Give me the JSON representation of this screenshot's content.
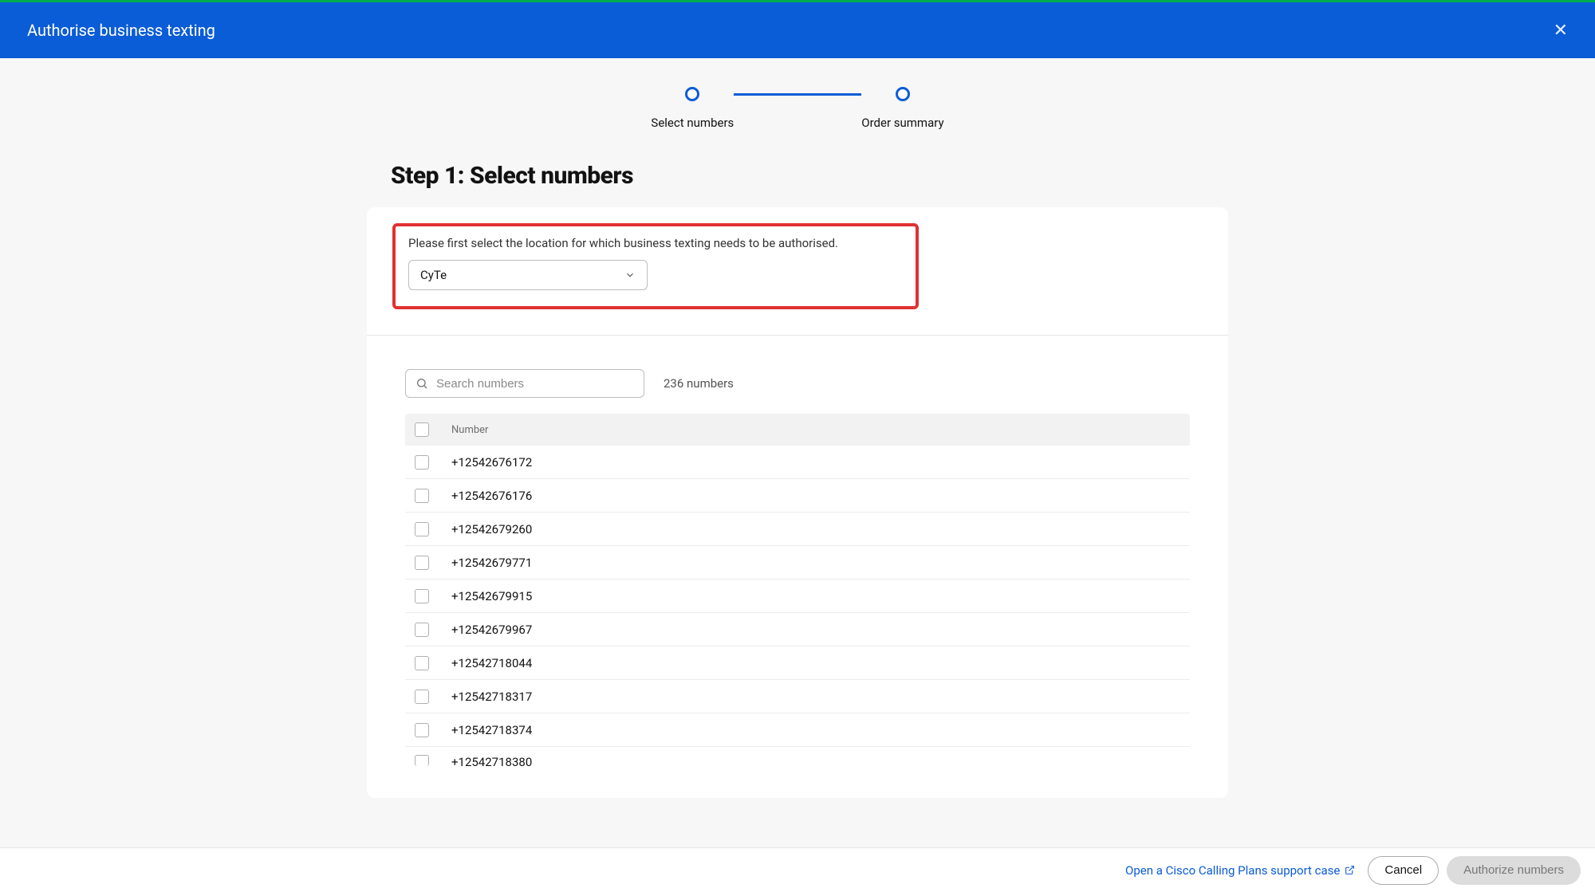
{
  "header": {
    "title": "Authorise business texting"
  },
  "stepper": {
    "step1_label": "Select numbers",
    "step2_label": "Order summary"
  },
  "main": {
    "step_heading": "Step 1: Select numbers",
    "instruction": "Please first select the location for which business texting needs to be authorised.",
    "location_value": "CyTe",
    "search_placeholder": "Search numbers",
    "count_text": "236 numbers",
    "column_header": "Number",
    "numbers": [
      "+12542676172",
      "+12542676176",
      "+12542679260",
      "+12542679771",
      "+12542679915",
      "+12542679967",
      "+12542718044",
      "+12542718317",
      "+12542718374",
      "+12542718380"
    ]
  },
  "footer": {
    "support_link": "Open a Cisco Calling Plans support case",
    "cancel_label": "Cancel",
    "authorize_label": "Authorize numbers"
  }
}
